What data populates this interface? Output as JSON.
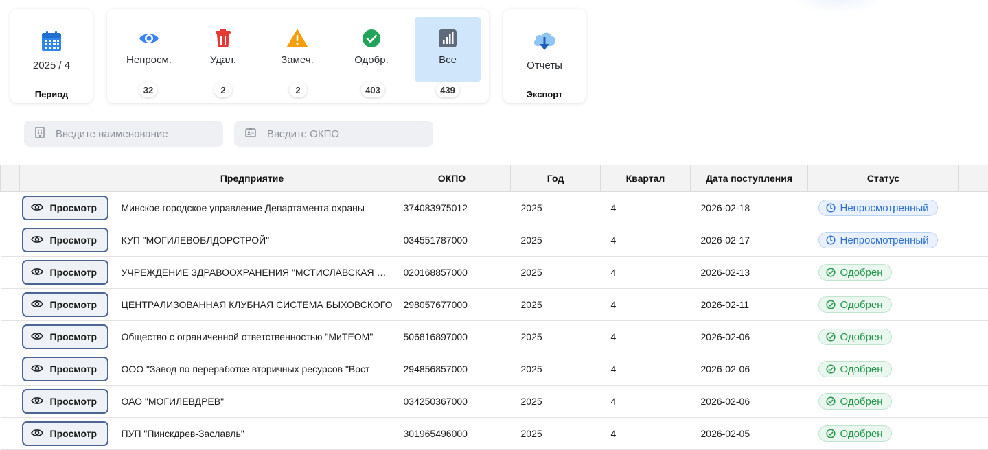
{
  "period": {
    "value": "2025 / 4",
    "caption": "Период"
  },
  "filters": [
    {
      "label": "Непросм.",
      "count": "32",
      "icon": "eye-icon",
      "color": "#3b82f6"
    },
    {
      "label": "Удал.",
      "count": "2",
      "icon": "trash-icon",
      "color": "#e53935"
    },
    {
      "label": "Замеч.",
      "count": "2",
      "icon": "warning-icon",
      "color": "#f59e0b"
    },
    {
      "label": "Одобр.",
      "count": "403",
      "icon": "check-circle-icon",
      "color": "#22a35a"
    },
    {
      "label": "Все",
      "count": "439",
      "icon": "bar-chart-icon",
      "color": "#5f6b7a",
      "active": true
    }
  ],
  "export": {
    "label": "Отчеты",
    "caption": "Экспорт",
    "icon": "cloud-download-icon"
  },
  "search": {
    "name_placeholder": "Введите наименование",
    "okpo_placeholder": "Введите ОКПО"
  },
  "table": {
    "headers": {
      "company": "Предприятие",
      "okpo": "ОКПО",
      "year": "Год",
      "quarter": "Квартал",
      "date": "Дата поступления",
      "status": "Статус"
    },
    "view_label": "Просмотр",
    "rows": [
      {
        "company": "Минское городское управление Департамента охраны",
        "okpo": "374083975012",
        "year": "2025",
        "quarter": "4",
        "date": "2026-02-18",
        "status": "Непросмотренный",
        "status_type": "pending"
      },
      {
        "company": "КУП \"МОГИЛЕВОБЛДОРСТРОЙ\"",
        "okpo": "034551787000",
        "year": "2025",
        "quarter": "4",
        "date": "2026-02-17",
        "status": "Непросмотренный",
        "status_type": "pending"
      },
      {
        "company": "УЧРЕЖДЕНИЕ ЗДРАВООХРАНЕНИЯ \"МСТИСЛАВСКАЯ ЦЕНТРАЛЬНАЯ",
        "okpo": "020168857000",
        "year": "2025",
        "quarter": "4",
        "date": "2026-02-13",
        "status": "Одобрен",
        "status_type": "approved"
      },
      {
        "company": "ЦЕНТРАЛИЗОВАННАЯ КЛУБНАЯ СИСТЕМА БЫХОВСКОГО",
        "okpo": "298057677000",
        "year": "2025",
        "quarter": "4",
        "date": "2026-02-11",
        "status": "Одобрен",
        "status_type": "approved"
      },
      {
        "company": "Общество с ограниченной ответственностью \"МиТЕОМ\"",
        "okpo": "506816897000",
        "year": "2025",
        "quarter": "4",
        "date": "2026-02-06",
        "status": "Одобрен",
        "status_type": "approved"
      },
      {
        "company": "ООО \"Завод по переработке вторичных ресурсов \"Вост",
        "okpo": "294856857000",
        "year": "2025",
        "quarter": "4",
        "date": "2026-02-06",
        "status": "Одобрен",
        "status_type": "approved"
      },
      {
        "company": "ОАО \"МОГИЛЕВДРЕВ\"",
        "okpo": "034250367000",
        "year": "2025",
        "quarter": "4",
        "date": "2026-02-06",
        "status": "Одобрен",
        "status_type": "approved"
      },
      {
        "company": "ПУП \"Пинскдрев-Заславль\"",
        "okpo": "301965496000",
        "year": "2025",
        "quarter": "4",
        "date": "2026-02-05",
        "status": "Одобрен",
        "status_type": "approved"
      }
    ]
  }
}
